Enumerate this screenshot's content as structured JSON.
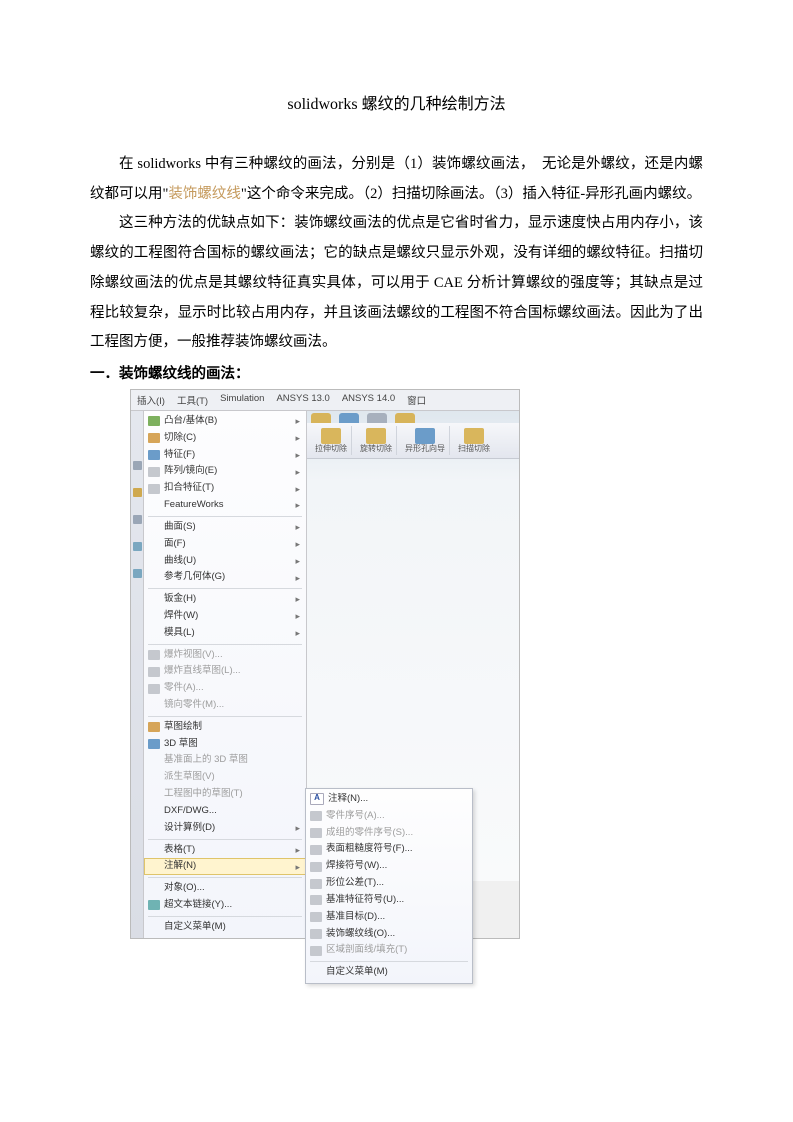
{
  "title": "solidworks 螺纹的几种绘制方法",
  "p1_a": "在 solidworks 中有三种螺纹的画法，分别是（1）装饰螺纹画法，　无论是外螺纹，还是内螺纹都可以用\"",
  "p1_link": "装饰螺纹线",
  "p1_b": "\"这个命令来完成。（2）扫描切除画法。（3）插入特征-异形孔画内螺纹。",
  "p2": "这三种方法的优缺点如下：装饰螺纹画法的优点是它省时省力，显示速度快占用内存小，该螺纹的工程图符合国标的螺纹画法；它的缺点是螺纹只显示外观，没有详细的螺纹特征。扫描切除螺纹画法的优点是其螺纹特征真实具体，可以用于 CAE 分析计算螺纹的强度等；其缺点是过程比较复杂，显示时比较占用内存，并且该画法螺纹的工程图不符合国标螺纹画法。因此为了出工程图方便，一般推荐装饰螺纹画法。",
  "h1": "一．装饰螺纹线的画法：",
  "menubar": {
    "insert": "插入(I)",
    "tools": "工具(T)",
    "sim": "Simulation",
    "a13": "ANSYS 13.0",
    "a14": "ANSYS 14.0",
    "win": "窗口"
  },
  "toolbar": {
    "b1": "拉伸切除",
    "b2": "旋转切除",
    "b3": "异形孔向导",
    "b4": "扫描切除"
  },
  "menu1": {
    "m1": "凸台/基体(B)",
    "m2": "切除(C)",
    "m3": "特征(F)",
    "m4": "阵列/镜向(E)",
    "m5": "扣合特征(T)",
    "m6": "FeatureWorks",
    "m7": "曲面(S)",
    "m8": "面(F)",
    "m9": "曲线(U)",
    "m10": "参考几何体(G)",
    "m11": "钣金(H)",
    "m12": "焊件(W)",
    "m13": "模具(L)",
    "m14": "爆炸视图(V)...",
    "m15": "爆炸直线草图(L)...",
    "m16": "零件(A)...",
    "m17": "镜向零件(M)...",
    "m18": "草图绘制",
    "m19": "3D 草图",
    "m20": "基准面上的 3D 草图",
    "m21": "派生草图(V)",
    "m22": "工程图中的草图(T)",
    "m23": "DXF/DWG...",
    "m24": "设计算例(D)",
    "m25": "表格(T)",
    "m26": "注解(N)",
    "m27": "对象(O)...",
    "m28": "超文本链接(Y)...",
    "m29": "自定义菜单(M)"
  },
  "submenu": {
    "s1": "注释(N)...",
    "s2": "零件序号(A)...",
    "s3": "成组的零件序号(S)...",
    "s4": "表面粗糙度符号(F)...",
    "s5": "焊接符号(W)...",
    "s6": "形位公差(T)...",
    "s7": "基准特征符号(U)...",
    "s8": "基准目标(D)...",
    "s9": "装饰螺纹线(O)...",
    "s10": "区域剖面线/填充(T)",
    "s11": "自定义菜单(M)"
  }
}
